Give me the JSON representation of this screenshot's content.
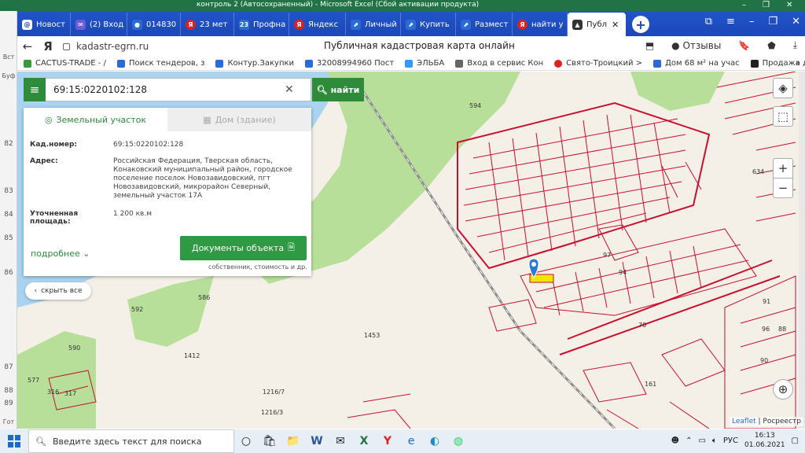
{
  "excel": {
    "title": "контроль 2 (Автосохраненный) - Microsoft Excel (Сбой активации продукта)",
    "row_numbers": [
      "82",
      "83",
      "84",
      "85",
      "86",
      "87",
      "88",
      "89"
    ],
    "cell_text_fragment": "Вст",
    "cell_text_fragment2": "Буф",
    "bottom_label": "Гот"
  },
  "tabs": [
    {
      "label": "Новост",
      "color": "#1b47b8"
    },
    {
      "label": "(2) Вход",
      "color": "#6b5bd6"
    },
    {
      "label": "014830",
      "color": "#2a6bd6"
    },
    {
      "label": "23 мет",
      "color": "#e02020"
    },
    {
      "label": "Профна",
      "color": "#2a6bd6"
    },
    {
      "label": "Яндекс",
      "color": "#e02020"
    },
    {
      "label": "Личный",
      "color": "#2a6bd6"
    },
    {
      "label": "Купить",
      "color": "#2a6bd6"
    },
    {
      "label": "Размест",
      "color": "#2a6bd6"
    },
    {
      "label": "найти у",
      "color": "#e02020"
    },
    {
      "label": "Публ",
      "color": "#333333"
    }
  ],
  "address": {
    "url": "kadastr-egrn.ru",
    "page_title": "Публичная кадастровая карта онлайн",
    "reviews_label": "Отзывы"
  },
  "bookmarks": [
    {
      "label": "CACTUS-TRADE - /",
      "color": "#3a9a3a"
    },
    {
      "label": "Поиск тендеров, з",
      "color": "#2a6bd6"
    },
    {
      "label": "Контур.Закупки",
      "color": "#2a6bd6"
    },
    {
      "label": "32008994960 Пост",
      "color": "#2a6bd6"
    },
    {
      "label": "ЭЛЬБА",
      "color": "#3399ff"
    },
    {
      "label": "Вход в сервис Кон",
      "color": "#666666"
    },
    {
      "label": "Свято-Троицкий >",
      "color": "#e02020"
    },
    {
      "label": "Дом 68 м² на учас",
      "color": "#2a6bd6"
    },
    {
      "label": "Продажа дома с",
      "color": "#222222"
    }
  ],
  "search": {
    "value": "69:15:0220102:128",
    "find_label": "найти"
  },
  "panel": {
    "tab_land": "Земельный участок",
    "tab_house": "Дом (здание)",
    "rows": [
      {
        "label": "Кад.номер:",
        "value": "69:15:0220102:128"
      },
      {
        "label": "Адрес:",
        "value": "Российская Федерация, Тверская область, Конаковский муниципальный район, городское поселение поселок Новозавидовский, пгт Новозавидовский, микрорайон Северный, земельный участок 17А"
      },
      {
        "label": "Уточненная площадь:",
        "value": "1 200 кв.м"
      }
    ],
    "more_label": "подробнее",
    "docs_label": "Документы объекта",
    "docs_sub": "собственник, стоимость и др.",
    "hide_all": "скрыть все"
  },
  "map_labels": [
    {
      "text": "594"
    },
    {
      "text": "592"
    },
    {
      "text": "590"
    },
    {
      "text": "1412"
    },
    {
      "text": "1453"
    },
    {
      "text": "1216/7"
    },
    {
      "text": "1216/3"
    },
    {
      "text": "316"
    },
    {
      "text": "317"
    },
    {
      "text": "577"
    },
    {
      "text": "586"
    },
    {
      "text": "634"
    },
    {
      "text": "161"
    },
    {
      "text": "96"
    },
    {
      "text": "88"
    },
    {
      "text": "94"
    },
    {
      "text": "70"
    },
    {
      "text": "90"
    },
    {
      "text": "97"
    },
    {
      "text": "91"
    }
  ],
  "attribution": {
    "leaflet": "Leaflet",
    "rosreestr": "| Росреестр"
  },
  "taskbar": {
    "search_placeholder": "Введите здесь текст для поиска",
    "lang": "РУС",
    "time": "16:13",
    "date": "01.06.2021"
  },
  "colors": {
    "accent_green": "#2e8b3a",
    "parcel_red": "#c8102e",
    "water": "#a9d3f0",
    "forest": "#b8df9a"
  }
}
